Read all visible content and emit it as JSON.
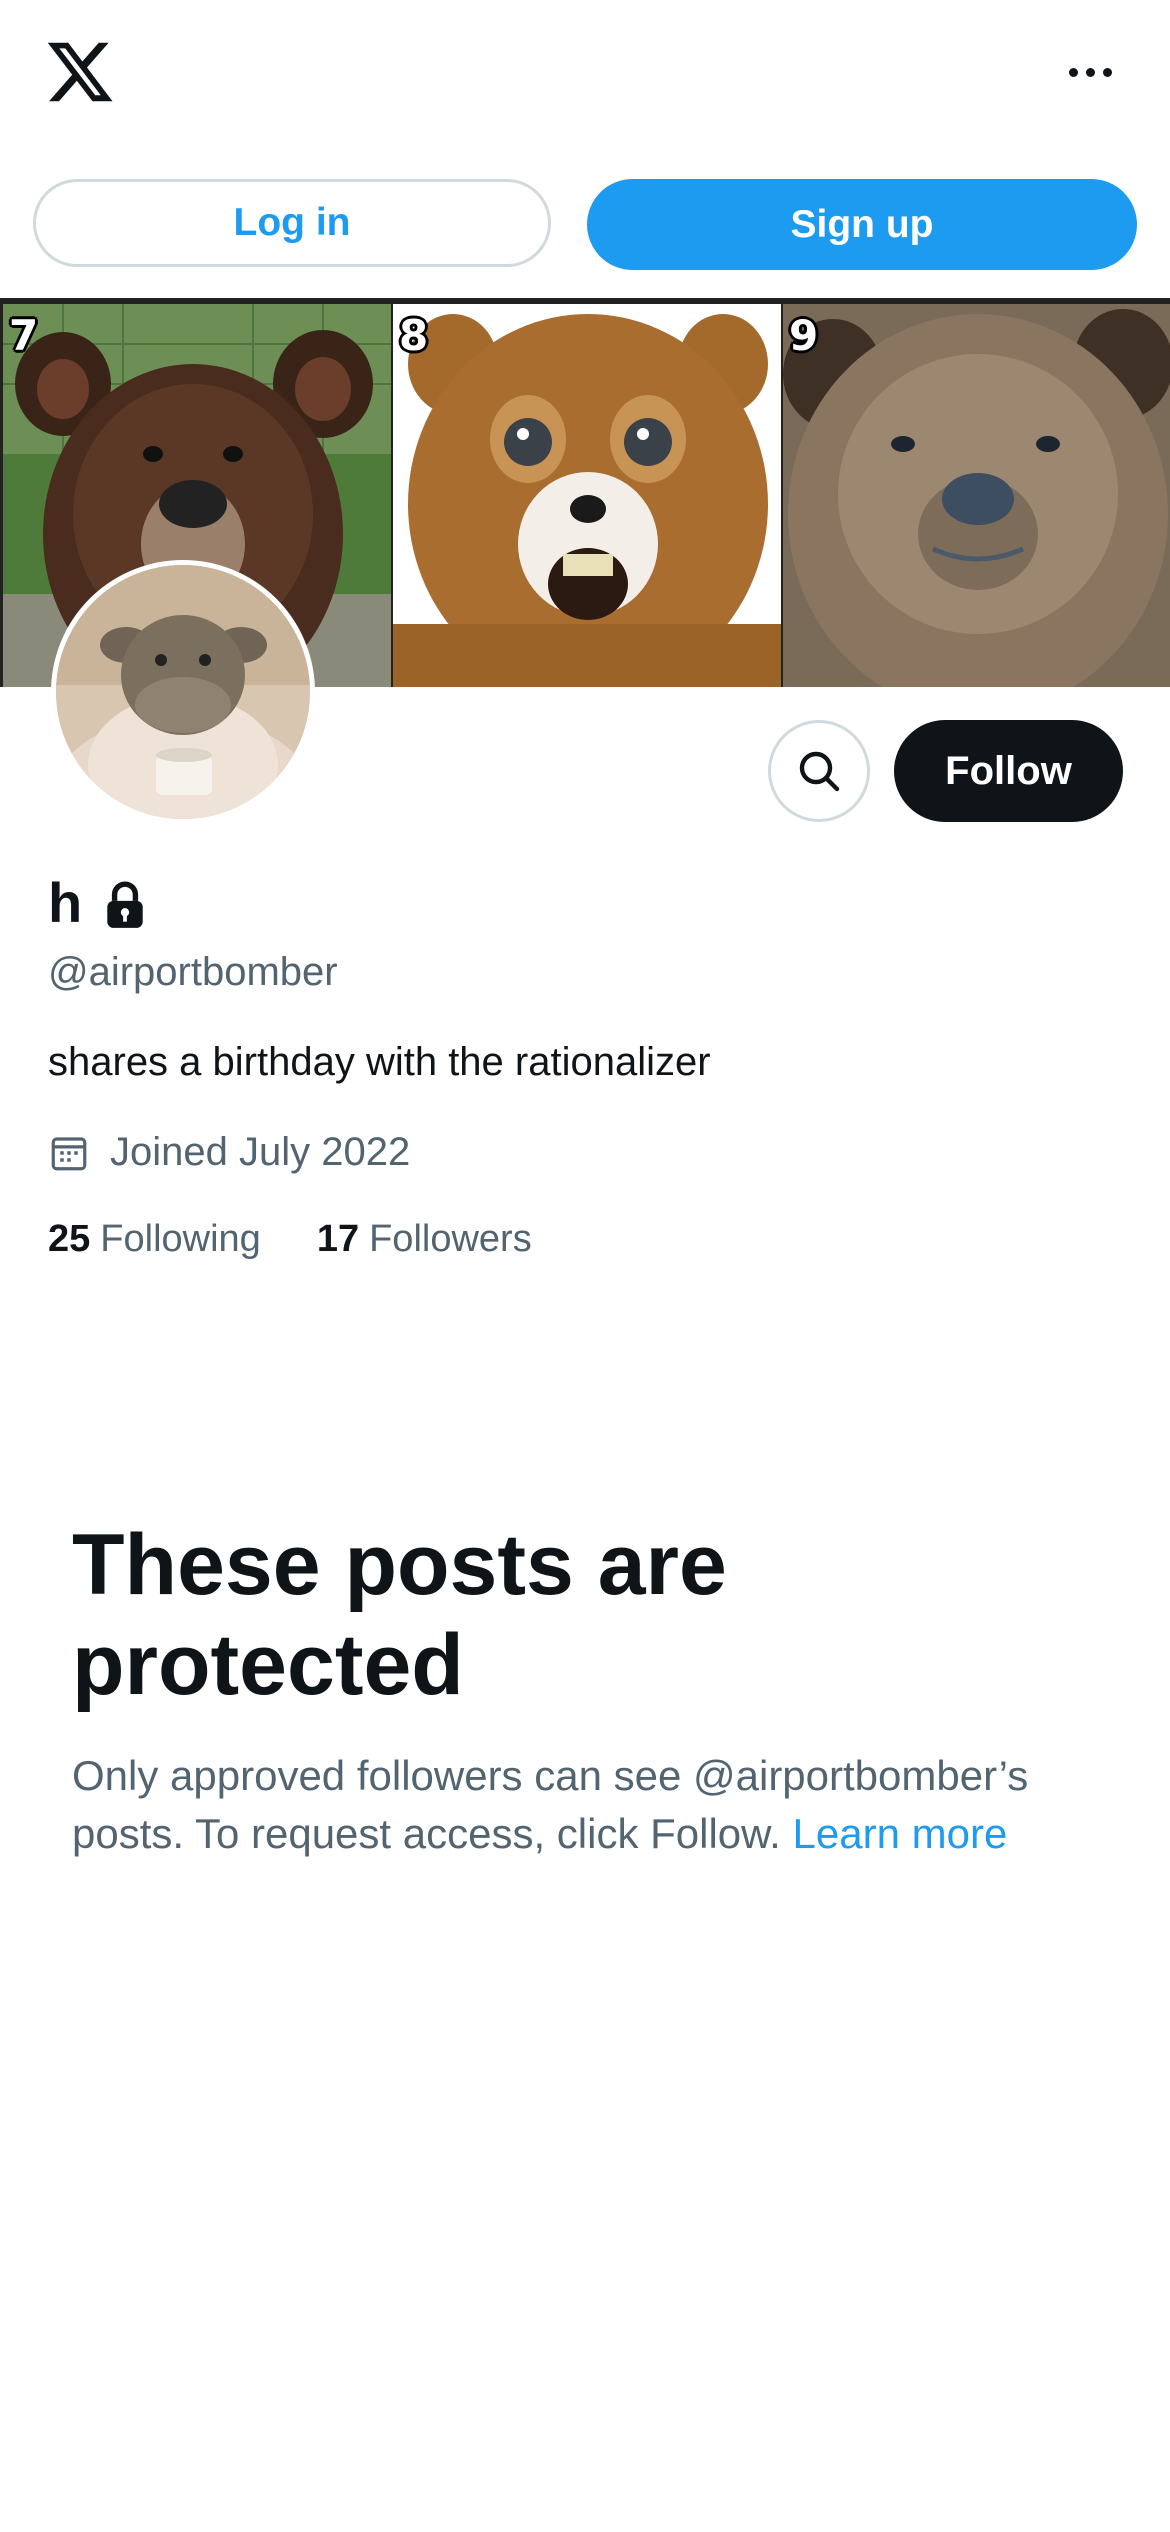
{
  "header": {
    "logo_icon": "x-logo-icon",
    "more_icon": "more-horizontal-icon"
  },
  "auth": {
    "login_label": "Log in",
    "signup_label": "Sign up"
  },
  "banner": {
    "panels": [
      {
        "number": "7",
        "subject": "brown bear photo"
      },
      {
        "number": "8",
        "subject": "plush teddy bear"
      },
      {
        "number": "9",
        "subject": "grizzly bear photo"
      }
    ]
  },
  "profile": {
    "name": "h",
    "locked_icon": "lock-icon",
    "handle": "@airportbomber",
    "bio": "shares a birthday with the rationalizer",
    "joined": "Joined July 2022",
    "following_count": "25",
    "following_label": "Following",
    "followers_count": "17",
    "followers_label": "Followers",
    "follow_label": "Follow"
  },
  "protected": {
    "title": "These posts are protected",
    "description": "Only approved followers can see @airportbomber’s posts. To request access, click Follow.",
    "learn_more": "Learn more"
  },
  "colors": {
    "accent": "#1d9bf0",
    "dark": "#0f1419",
    "muted": "#536471",
    "border": "#cfd9de"
  }
}
